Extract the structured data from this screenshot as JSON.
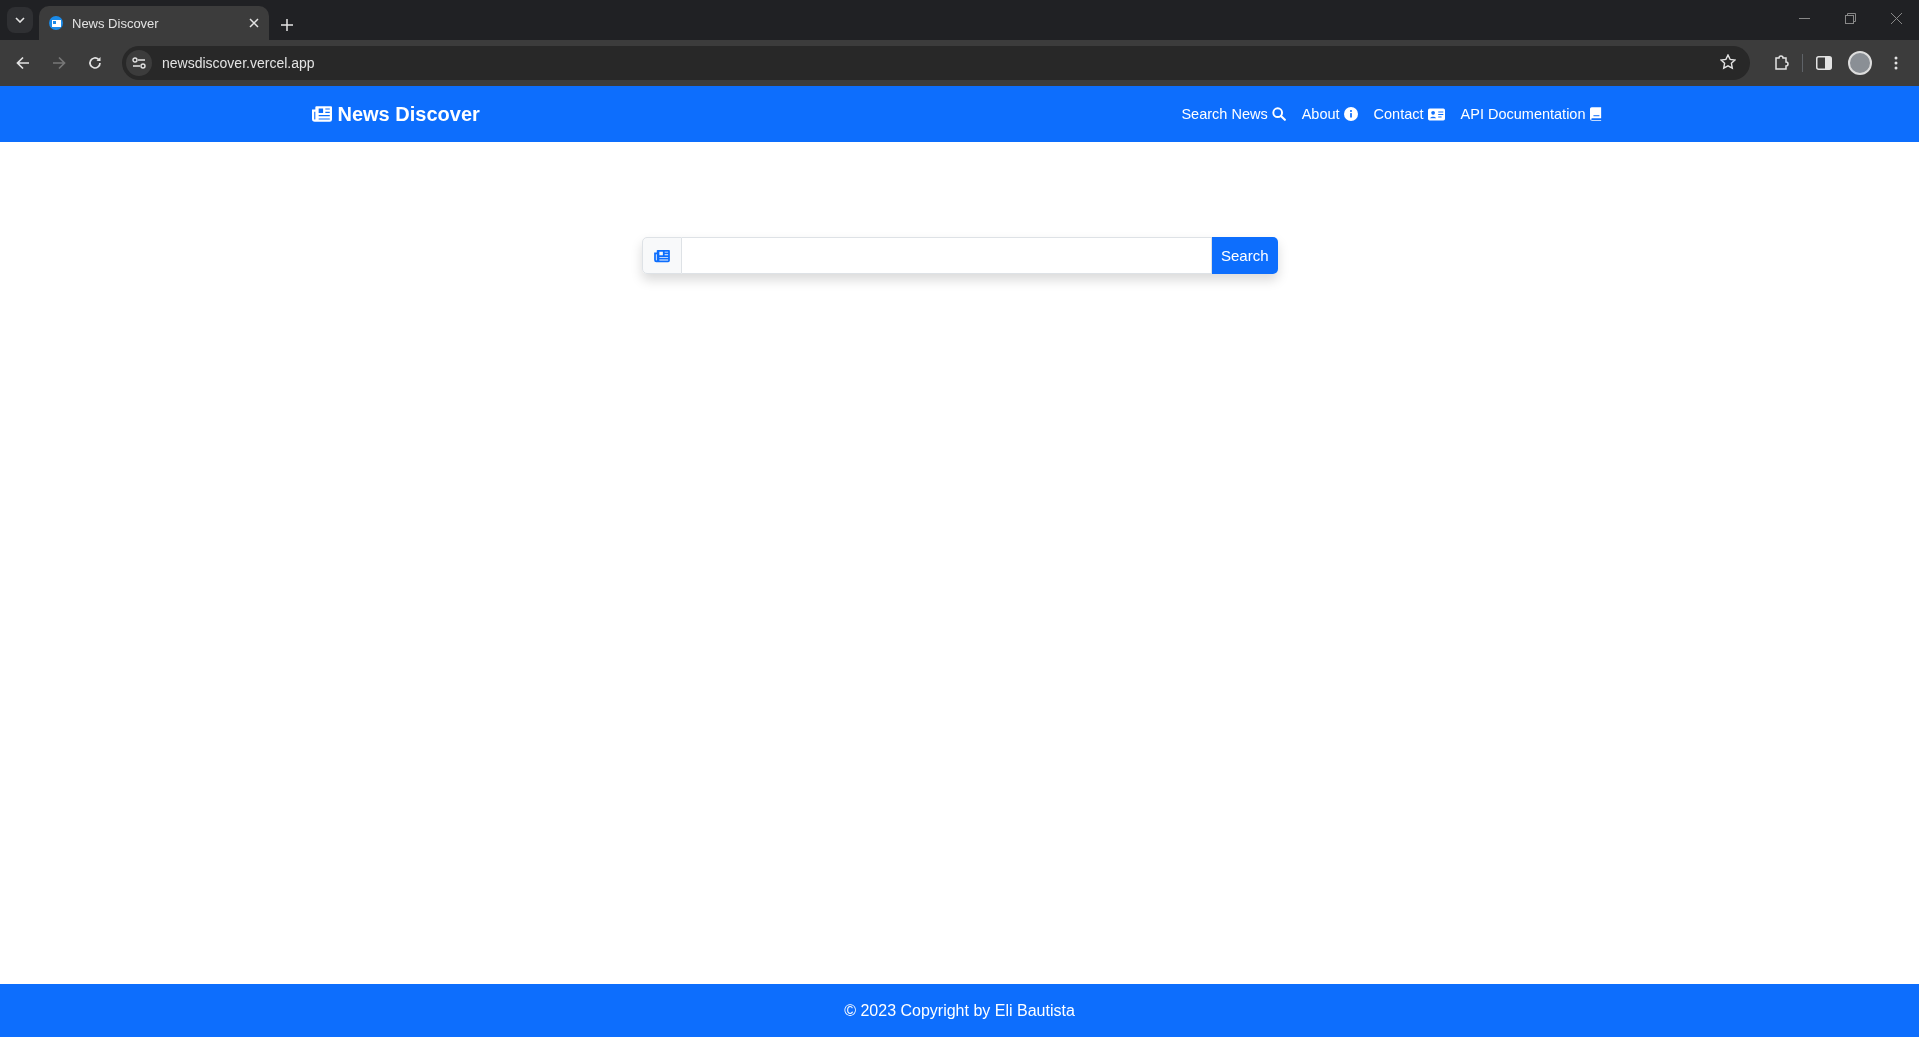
{
  "browser": {
    "tab": {
      "title": "News Discover",
      "selected": true
    },
    "address": "newsdiscover.vercel.app"
  },
  "navbar": {
    "brand": "News Discover",
    "links": [
      {
        "label": "Search News",
        "kind": "search"
      },
      {
        "label": "About",
        "kind": "info"
      },
      {
        "label": "Contact",
        "kind": "contact"
      },
      {
        "label": "API Documentation",
        "kind": "book"
      }
    ]
  },
  "search": {
    "button": "Search"
  },
  "footer": {
    "text": "© 2023 Copyright by Eli Bautista"
  }
}
